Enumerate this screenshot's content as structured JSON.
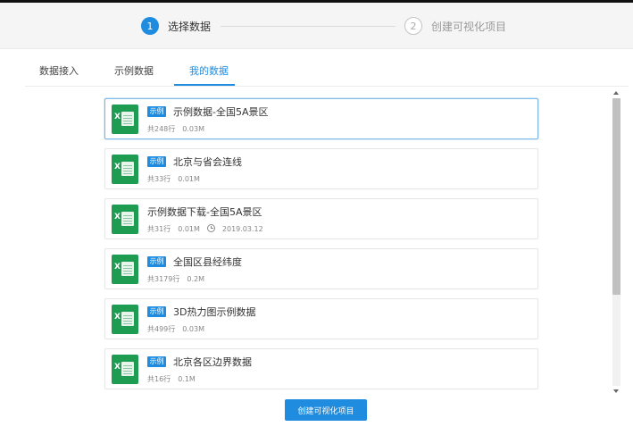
{
  "stepper": {
    "step1_number": "1",
    "step1_label": "选择数据",
    "step2_number": "2",
    "step2_label": "创建可视化项目"
  },
  "tabs": [
    {
      "label": "数据接入"
    },
    {
      "label": "示例数据"
    },
    {
      "label": "我的数据",
      "active": true
    }
  ],
  "badge_label": "示例",
  "items": [
    {
      "title": "示例数据-全国5A景区",
      "badge": true,
      "rows": "共248行",
      "size": "0.03M",
      "date": "",
      "selected": true
    },
    {
      "title": "北京与省会连线",
      "badge": true,
      "rows": "共33行",
      "size": "0.01M",
      "date": ""
    },
    {
      "title": "示例数据下载-全国5A景区",
      "badge": false,
      "rows": "共31行",
      "size": "0.01M",
      "date": "2019.03.12"
    },
    {
      "title": "全国区县经纬度",
      "badge": true,
      "rows": "共3179行",
      "size": "0.2M",
      "date": ""
    },
    {
      "title": "3D热力图示例数据",
      "badge": true,
      "rows": "共499行",
      "size": "0.03M",
      "date": ""
    },
    {
      "title": "北京各区边界数据",
      "badge": true,
      "rows": "共16行",
      "size": "0.1M",
      "date": ""
    }
  ],
  "icons": {
    "file": "excel-file-icon",
    "clock": "clock-icon"
  },
  "colors": {
    "accent": "#1f8ce0",
    "excel_green": "#1d9c52"
  },
  "create_button_label": "创建可视化项目"
}
